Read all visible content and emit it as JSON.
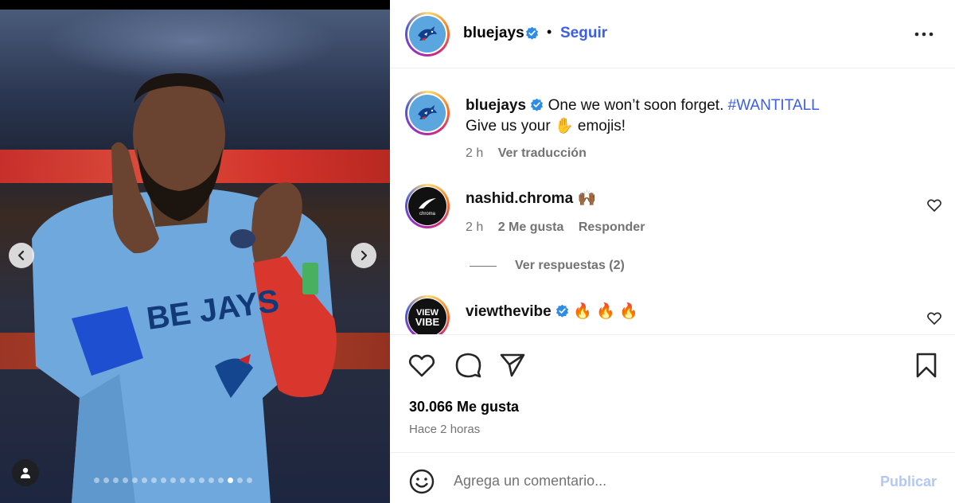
{
  "post": {
    "author": "bluejays",
    "separator": "•",
    "follow_label": "Seguir",
    "more_icon": "more-horizontal-icon"
  },
  "caption": {
    "username": "bluejays",
    "text": "One we won’t soon forget.",
    "hashtag": "#WANTITALL",
    "line2_prefix": "Give us your",
    "line2_emoji": "✋",
    "line2_suffix": "emojis!",
    "time": "2 h",
    "translate_label": "Ver traducción"
  },
  "comments": [
    {
      "username": "nashid.chroma",
      "text": "🙌🏾",
      "time": "2 h",
      "likes": "2 Me gusta",
      "reply_label": "Responder"
    },
    {
      "username": "viewthevibe",
      "text": "🔥 🔥 🔥"
    }
  ],
  "view_replies_label": "Ver respuestas (2)",
  "avatar_text": {
    "vibe_line1": "VIEW",
    "vibe_line2": "VIBE",
    "chroma": "chroma"
  },
  "stats": {
    "likes": "30.066 Me gusta",
    "time_ago": "Hace 2 horas"
  },
  "comment_box": {
    "placeholder": "Agrega un comentario...",
    "publish_label": "Publicar"
  },
  "carousel": {
    "total_slides": 17,
    "active_slide": 14
  },
  "colors": {
    "link_blue": "#3b5ee6",
    "muted": "#737373",
    "publish_disabled": "#b3c7f7",
    "jersey_blue": "#6fa8dc"
  }
}
